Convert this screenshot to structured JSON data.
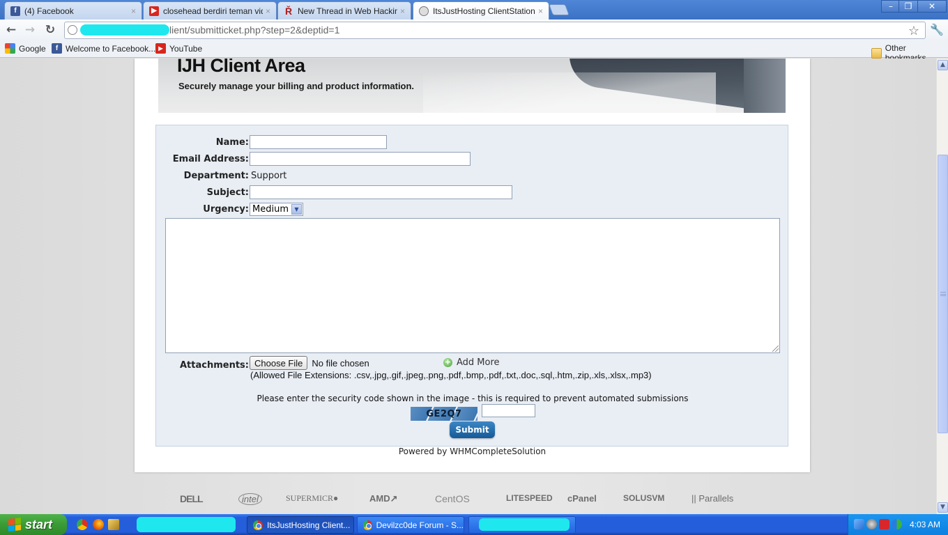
{
  "browser": {
    "tabs": [
      {
        "label": "(4) Facebook",
        "icon": "facebook-icon",
        "active": false
      },
      {
        "label": "closehead berdiri teman video",
        "icon": "youtube-icon",
        "active": false
      },
      {
        "label": "New Thread in Web Hacking",
        "icon": "forum-icon",
        "active": false
      },
      {
        "label": "ItsJustHosting ClientStation",
        "icon": "globe-icon",
        "active": true
      }
    ],
    "tab_close_glyph": "×",
    "window_controls": {
      "minimize": "–",
      "restore": "❐",
      "close": "✕"
    },
    "nav": {
      "back": "←",
      "forward": "→",
      "reload": "↻"
    },
    "url_visible": "lient/submitticket.php?step=2&deptid=1",
    "star_glyph": "☆",
    "wrench_glyph": "🔧",
    "bookmarks": [
      {
        "label": "Google",
        "icon": "google-icon"
      },
      {
        "label": "Welcome to Facebook...",
        "icon": "facebook-icon"
      },
      {
        "label": "YouTube",
        "icon": "youtube-icon"
      }
    ],
    "other_bookmarks": "Other bookmarks"
  },
  "page": {
    "banner": {
      "title": "IJH Client Area",
      "tagline": "Securely manage your billing and product information."
    },
    "form": {
      "name": {
        "label": "Name:",
        "value": ""
      },
      "email": {
        "label": "Email Address:",
        "value": ""
      },
      "department": {
        "label": "Department:",
        "value": "Support"
      },
      "subject": {
        "label": "Subject:",
        "value": ""
      },
      "urgency": {
        "label": "Urgency:",
        "selected": "Medium"
      },
      "message": {
        "value": ""
      },
      "attachments": {
        "label": "Attachments:",
        "choose_button": "Choose File",
        "status": "No file chosen",
        "add_more": "Add More",
        "allowed": "(Allowed File Extensions: .csv,.jpg,.gif,.jpeg,.png,.pdf,.bmp,.pdf,.txt,.doc,.sql,.htm,.zip,.xls,.xlsx,.mp3)"
      },
      "security_prompt": "Please enter the security code shown in the image - this is required to prevent automated submissions",
      "captcha_text": "GE2Q7",
      "captcha_value": "",
      "submit_label": "Submit"
    },
    "powered_by": "Powered by WHMCompleteSolution",
    "partners": [
      "DELL",
      "intel",
      "SUPERMICR●",
      "AMD↗",
      "CentOS",
      "LITESPEED",
      "cPanel",
      "SOLUSVM",
      "|| Parallels"
    ]
  },
  "taskbar": {
    "start_label": "start",
    "tasks": [
      {
        "label": "ItsJustHosting Client...",
        "active": true
      },
      {
        "label": "Devilzc0de Forum - S...",
        "active": false
      }
    ],
    "clock": "4:03 AM"
  }
}
